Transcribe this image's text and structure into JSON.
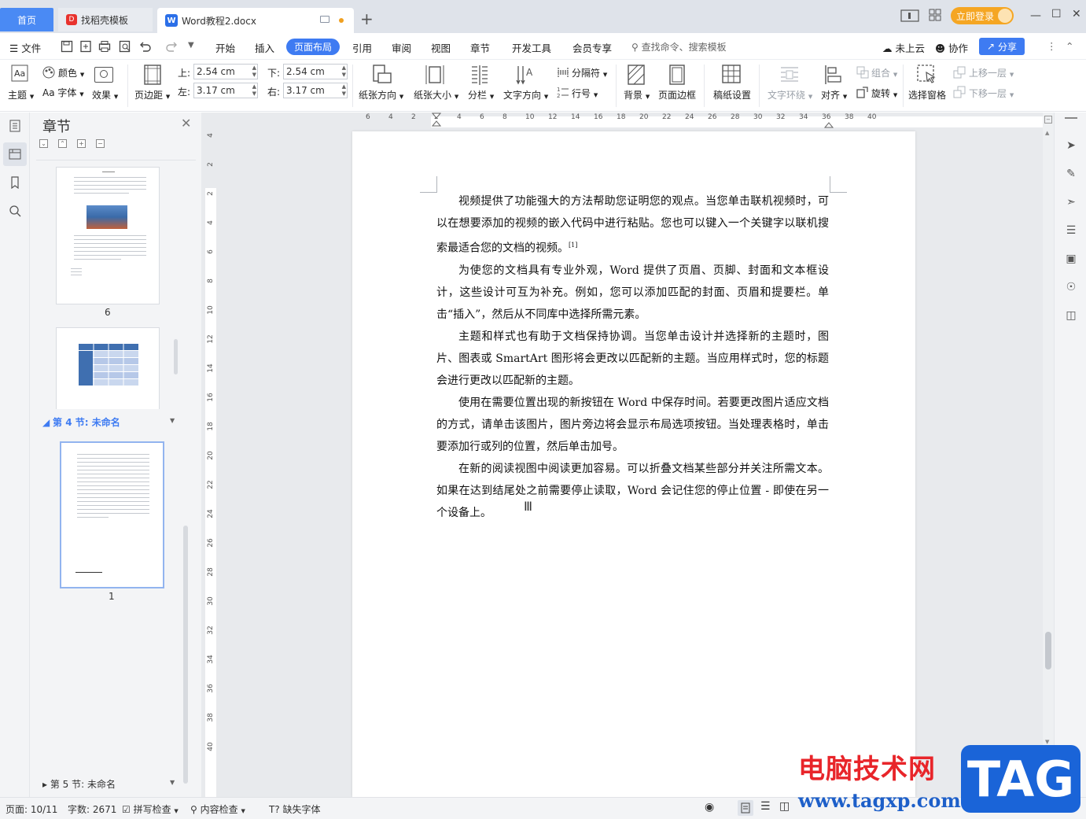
{
  "titlebar": {
    "home_tab": "首页",
    "docer_tab": "找稻壳模板",
    "docer_logo": "D",
    "doc_tab": "Word教程2.docx",
    "doc_logo": "W",
    "new_tab": "+",
    "login": "立即登录",
    "accent": "#4a8af4",
    "login_color": "#f5a623"
  },
  "menubar": {
    "file": "文件",
    "items": [
      "开始",
      "插入",
      "页面布局",
      "引用",
      "审阅",
      "视图",
      "章节",
      "开发工具",
      "会员专享"
    ],
    "active": "页面布局",
    "search": "查找命令、搜索模板",
    "cloud": "未上云",
    "collab": "协作",
    "share": "分享"
  },
  "ribbon": {
    "theme": "主题",
    "colors": "颜色",
    "fonts": "Aa 字体",
    "effects": "效果",
    "margins": "页边距",
    "top_label": "上:",
    "top_value": "2.54 cm",
    "bottom_label": "下:",
    "bottom_value": "2.54 cm",
    "left_label": "左:",
    "left_value": "3.17 cm",
    "right_label": "右:",
    "right_value": "3.17 cm",
    "orientation": "纸张方向",
    "size": "纸张大小",
    "columns": "分栏",
    "text_direction": "文字方向",
    "breaks": "分隔符",
    "line_numbers": "行号",
    "background": "背景",
    "page_border": "页面边框",
    "manuscript": "稿纸设置",
    "wrap_text": "文字环绕",
    "align": "对齐",
    "group": "组合",
    "rotate": "旋转",
    "selection_pane": "选择窗格",
    "bring_forward": "上移一层",
    "send_backward": "下移一层"
  },
  "panel": {
    "title": "章节",
    "thumb1_num": "6",
    "section4": "第 4 节: 未命名",
    "thumb3_num": "1",
    "section5": "第 5 节: 未命名"
  },
  "ruler": {
    "h_numbers": [
      "6",
      "4",
      "2",
      "2",
      "4",
      "6",
      "8",
      "10",
      "12",
      "14",
      "16",
      "18",
      "20",
      "22",
      "24",
      "26",
      "28",
      "30",
      "32",
      "34",
      "36",
      "38",
      "40"
    ],
    "v_numbers": [
      "4",
      "2",
      "2",
      "4",
      "6",
      "8",
      "10",
      "12",
      "14",
      "16",
      "18",
      "20",
      "22",
      "24",
      "26",
      "28",
      "30",
      "32",
      "34",
      "36",
      "38",
      "40"
    ]
  },
  "document": {
    "paragraphs": [
      "视频提供了功能强大的方法帮助您证明您的观点。当您单击联机视频时，可以在想要添加的视频的嵌入代码中进行粘贴。您也可以键入一个关键字以联机搜索最适合您的文档的视频。",
      "为使您的文档具有专业外观，Word 提供了页眉、页脚、封面和文本框设计，这些设计可互为补充。例如，您可以添加匹配的封面、页眉和提要栏。单击“插入”，然后从不同库中选择所需元素。",
      "主题和样式也有助于文档保持协调。当您单击设计并选择新的主题时，图片、图表或 SmartArt 图形将会更改以匹配新的主题。当应用样式时，您的标题会进行更改以匹配新的主题。",
      "使用在需要位置出现的新按钮在 Word 中保存时间。若要更改图片适应文档的方式，请单击该图片，图片旁边将会显示布局选项按钮。当处理表格时，单击要添加行或列的位置，然后单击加号。",
      "在新的阅读视图中阅读更加容易。可以折叠文档某些部分并关注所需文本。如果在达到结尾处之前需要停止读取，Word 会记住您的停止位置 - 即使在另一个设备上。"
    ],
    "footnote_ref": "[1]"
  },
  "statusbar": {
    "page": "页面: 10/11",
    "words": "字数: 2671",
    "spellcheck": "拼写检查",
    "content_check": "内容检查",
    "missing_fonts": "缺失字体"
  },
  "watermark": {
    "site": "电脑技术网",
    "url": "www.tagxp.com",
    "tag": "TAG"
  }
}
